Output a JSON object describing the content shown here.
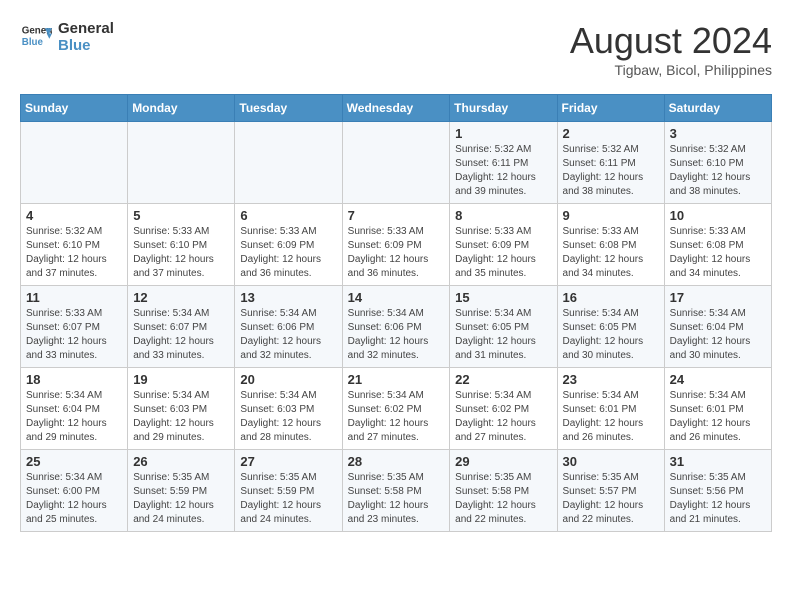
{
  "header": {
    "logo_line1": "General",
    "logo_line2": "Blue",
    "month_year": "August 2024",
    "location": "Tigbaw, Bicol, Philippines"
  },
  "days_of_week": [
    "Sunday",
    "Monday",
    "Tuesday",
    "Wednesday",
    "Thursday",
    "Friday",
    "Saturday"
  ],
  "weeks": [
    [
      {
        "num": "",
        "info": ""
      },
      {
        "num": "",
        "info": ""
      },
      {
        "num": "",
        "info": ""
      },
      {
        "num": "",
        "info": ""
      },
      {
        "num": "1",
        "info": "Sunrise: 5:32 AM\nSunset: 6:11 PM\nDaylight: 12 hours\nand 39 minutes."
      },
      {
        "num": "2",
        "info": "Sunrise: 5:32 AM\nSunset: 6:11 PM\nDaylight: 12 hours\nand 38 minutes."
      },
      {
        "num": "3",
        "info": "Sunrise: 5:32 AM\nSunset: 6:10 PM\nDaylight: 12 hours\nand 38 minutes."
      }
    ],
    [
      {
        "num": "4",
        "info": "Sunrise: 5:32 AM\nSunset: 6:10 PM\nDaylight: 12 hours\nand 37 minutes."
      },
      {
        "num": "5",
        "info": "Sunrise: 5:33 AM\nSunset: 6:10 PM\nDaylight: 12 hours\nand 37 minutes."
      },
      {
        "num": "6",
        "info": "Sunrise: 5:33 AM\nSunset: 6:09 PM\nDaylight: 12 hours\nand 36 minutes."
      },
      {
        "num": "7",
        "info": "Sunrise: 5:33 AM\nSunset: 6:09 PM\nDaylight: 12 hours\nand 36 minutes."
      },
      {
        "num": "8",
        "info": "Sunrise: 5:33 AM\nSunset: 6:09 PM\nDaylight: 12 hours\nand 35 minutes."
      },
      {
        "num": "9",
        "info": "Sunrise: 5:33 AM\nSunset: 6:08 PM\nDaylight: 12 hours\nand 34 minutes."
      },
      {
        "num": "10",
        "info": "Sunrise: 5:33 AM\nSunset: 6:08 PM\nDaylight: 12 hours\nand 34 minutes."
      }
    ],
    [
      {
        "num": "11",
        "info": "Sunrise: 5:33 AM\nSunset: 6:07 PM\nDaylight: 12 hours\nand 33 minutes."
      },
      {
        "num": "12",
        "info": "Sunrise: 5:34 AM\nSunset: 6:07 PM\nDaylight: 12 hours\nand 33 minutes."
      },
      {
        "num": "13",
        "info": "Sunrise: 5:34 AM\nSunset: 6:06 PM\nDaylight: 12 hours\nand 32 minutes."
      },
      {
        "num": "14",
        "info": "Sunrise: 5:34 AM\nSunset: 6:06 PM\nDaylight: 12 hours\nand 32 minutes."
      },
      {
        "num": "15",
        "info": "Sunrise: 5:34 AM\nSunset: 6:05 PM\nDaylight: 12 hours\nand 31 minutes."
      },
      {
        "num": "16",
        "info": "Sunrise: 5:34 AM\nSunset: 6:05 PM\nDaylight: 12 hours\nand 30 minutes."
      },
      {
        "num": "17",
        "info": "Sunrise: 5:34 AM\nSunset: 6:04 PM\nDaylight: 12 hours\nand 30 minutes."
      }
    ],
    [
      {
        "num": "18",
        "info": "Sunrise: 5:34 AM\nSunset: 6:04 PM\nDaylight: 12 hours\nand 29 minutes."
      },
      {
        "num": "19",
        "info": "Sunrise: 5:34 AM\nSunset: 6:03 PM\nDaylight: 12 hours\nand 29 minutes."
      },
      {
        "num": "20",
        "info": "Sunrise: 5:34 AM\nSunset: 6:03 PM\nDaylight: 12 hours\nand 28 minutes."
      },
      {
        "num": "21",
        "info": "Sunrise: 5:34 AM\nSunset: 6:02 PM\nDaylight: 12 hours\nand 27 minutes."
      },
      {
        "num": "22",
        "info": "Sunrise: 5:34 AM\nSunset: 6:02 PM\nDaylight: 12 hours\nand 27 minutes."
      },
      {
        "num": "23",
        "info": "Sunrise: 5:34 AM\nSunset: 6:01 PM\nDaylight: 12 hours\nand 26 minutes."
      },
      {
        "num": "24",
        "info": "Sunrise: 5:34 AM\nSunset: 6:01 PM\nDaylight: 12 hours\nand 26 minutes."
      }
    ],
    [
      {
        "num": "25",
        "info": "Sunrise: 5:34 AM\nSunset: 6:00 PM\nDaylight: 12 hours\nand 25 minutes."
      },
      {
        "num": "26",
        "info": "Sunrise: 5:35 AM\nSunset: 5:59 PM\nDaylight: 12 hours\nand 24 minutes."
      },
      {
        "num": "27",
        "info": "Sunrise: 5:35 AM\nSunset: 5:59 PM\nDaylight: 12 hours\nand 24 minutes."
      },
      {
        "num": "28",
        "info": "Sunrise: 5:35 AM\nSunset: 5:58 PM\nDaylight: 12 hours\nand 23 minutes."
      },
      {
        "num": "29",
        "info": "Sunrise: 5:35 AM\nSunset: 5:58 PM\nDaylight: 12 hours\nand 22 minutes."
      },
      {
        "num": "30",
        "info": "Sunrise: 5:35 AM\nSunset: 5:57 PM\nDaylight: 12 hours\nand 22 minutes."
      },
      {
        "num": "31",
        "info": "Sunrise: 5:35 AM\nSunset: 5:56 PM\nDaylight: 12 hours\nand 21 minutes."
      }
    ]
  ]
}
